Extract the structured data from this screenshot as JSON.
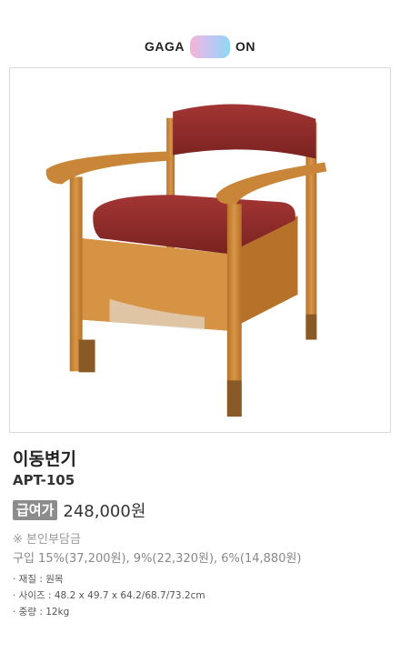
{
  "logo": {
    "left": "GAGA",
    "right": "ON"
  },
  "product": {
    "image_alt": "portable toilet chair",
    "name": "이동변기",
    "model": "APT-105",
    "price_badge": "급여가",
    "price": "248,000원",
    "note": "※ 본인부담금",
    "copay": "구입 15%(37,200원), 9%(22,320원), 6%(14,880원)",
    "specs": [
      "· 재질 : 원목",
      "· 사이즈 : 48.2 x 49.7 x 64.2/68.7/73.2cm",
      "· 중량 : 12kg"
    ]
  },
  "colors": {
    "wood": "#d08a3a",
    "leather": "#8e2a28",
    "badge": "#8c8c8c"
  }
}
